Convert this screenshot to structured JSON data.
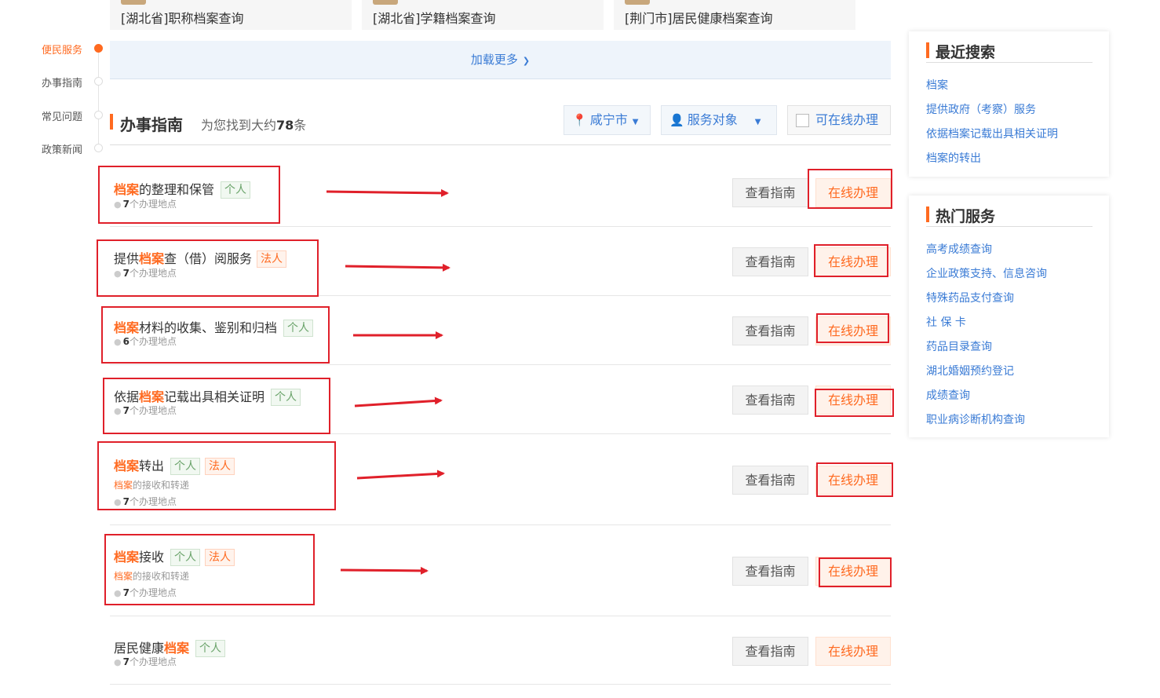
{
  "top_cards": [
    {
      "text": "[湖北省]职称档案查询"
    },
    {
      "text": "[湖北省]学籍档案查询"
    },
    {
      "text": "[荆门市]居民健康档案查询"
    }
  ],
  "side_nav": [
    {
      "label": "便民服务",
      "active": true
    },
    {
      "label": "办事指南",
      "active": false
    },
    {
      "label": "常见问题",
      "active": false
    },
    {
      "label": "政策新闻",
      "active": false
    }
  ],
  "load_more": "加载更多",
  "section": {
    "title": "办事指南",
    "count_prefix": "为您找到大约",
    "count": "78",
    "count_suffix": "条"
  },
  "filters": {
    "city": "咸宁市",
    "audience": "服务对象",
    "online_only": "可在线办理"
  },
  "buttons": {
    "guide": "查看指南",
    "online": "在线办理"
  },
  "items": [
    {
      "pre": "",
      "hl": "档案",
      "post": "的整理和保管",
      "tags": [
        "个人"
      ],
      "sub_hl": "",
      "sub": "",
      "loc_n": "7",
      "loc": "个办理地点"
    },
    {
      "pre": "提供",
      "hl": "档案",
      "post": "查（借）阅服务",
      "tags": [
        "法人"
      ],
      "sub_hl": "",
      "sub": "",
      "loc_n": "7",
      "loc": "个办理地点"
    },
    {
      "pre": "",
      "hl": "档案",
      "post": "材料的收集、鉴别和归档",
      "tags": [
        "个人"
      ],
      "sub_hl": "",
      "sub": "",
      "loc_n": "6",
      "loc": "个办理地点"
    },
    {
      "pre": "依据",
      "hl": "档案",
      "post": "记载出具相关证明",
      "tags": [
        "个人"
      ],
      "sub_hl": "",
      "sub": "",
      "loc_n": "7",
      "loc": "个办理地点"
    },
    {
      "pre": "",
      "hl": "档案",
      "post": "转出",
      "tags": [
        "个人",
        "法人"
      ],
      "sub_hl": "档案",
      "sub": "的接收和转递",
      "loc_n": "7",
      "loc": "个办理地点"
    },
    {
      "pre": "",
      "hl": "档案",
      "post": "接收",
      "tags": [
        "个人",
        "法人"
      ],
      "sub_hl": "档案",
      "sub": "的接收和转递",
      "loc_n": "7",
      "loc": "个办理地点"
    },
    {
      "pre": "居民健康",
      "hl": "档案",
      "post": "",
      "tags": [
        "个人"
      ],
      "sub_hl": "",
      "sub": "",
      "loc_n": "7",
      "loc": "个办理地点"
    }
  ],
  "recent_search": {
    "title": "最近搜索",
    "links": [
      "档案",
      "提供政府（考察）服务",
      "依据档案记载出具相关证明",
      "档案的转出"
    ]
  },
  "hot_services": {
    "title": "热门服务",
    "links": [
      "高考成绩查询",
      "企业政策支持、信息咨询",
      "特殊药品支付查询",
      "社 保 卡",
      "药品目录查询",
      "湖北婚姻预约登记",
      "成绩查询",
      "职业病诊断机构查询"
    ]
  },
  "colors": {
    "accent": "#ff6a20",
    "link": "#3a7bd5",
    "annotation": "#e0202a"
  }
}
